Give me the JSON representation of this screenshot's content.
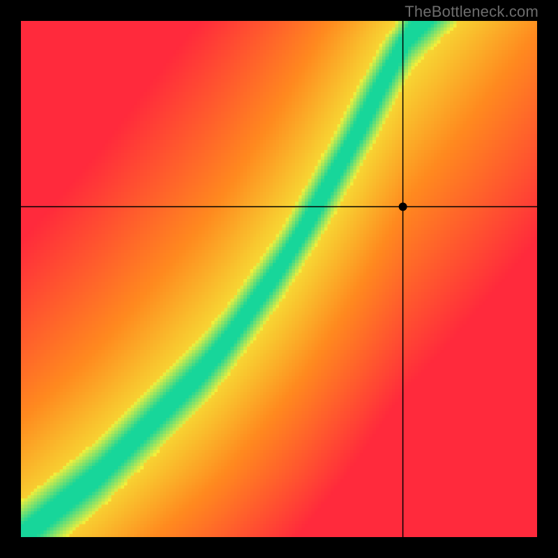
{
  "watermark": "TheBottleneck.com",
  "chart_data": {
    "type": "heatmap",
    "title": "",
    "xlabel": "",
    "ylabel": "",
    "xlim": [
      0,
      1
    ],
    "ylim": [
      0,
      1
    ],
    "grid_size": 160,
    "ridge": {
      "comment": "Center of the green optimal band as (x, y_optimal) pairs in normalized [0,1] axes, y measured from bottom.",
      "points": [
        [
          0.0,
          0.0
        ],
        [
          0.05,
          0.04
        ],
        [
          0.1,
          0.08
        ],
        [
          0.15,
          0.12
        ],
        [
          0.2,
          0.17
        ],
        [
          0.25,
          0.22
        ],
        [
          0.3,
          0.27
        ],
        [
          0.35,
          0.32
        ],
        [
          0.4,
          0.38
        ],
        [
          0.45,
          0.45
        ],
        [
          0.5,
          0.52
        ],
        [
          0.55,
          0.6
        ],
        [
          0.6,
          0.69
        ],
        [
          0.65,
          0.78
        ],
        [
          0.7,
          0.88
        ],
        [
          0.75,
          0.97
        ],
        [
          0.78,
          1.0
        ]
      ]
    },
    "band_halfwidth_vertical": 0.035,
    "marker": {
      "x": 0.74,
      "y": 0.64
    },
    "crosshair": {
      "x": 0.74,
      "y": 0.64
    },
    "color_stops": {
      "optimal": "#17d69a",
      "near": "#f5ef3a",
      "mid": "#ff8a1f",
      "far": "#ff2a3c"
    }
  }
}
